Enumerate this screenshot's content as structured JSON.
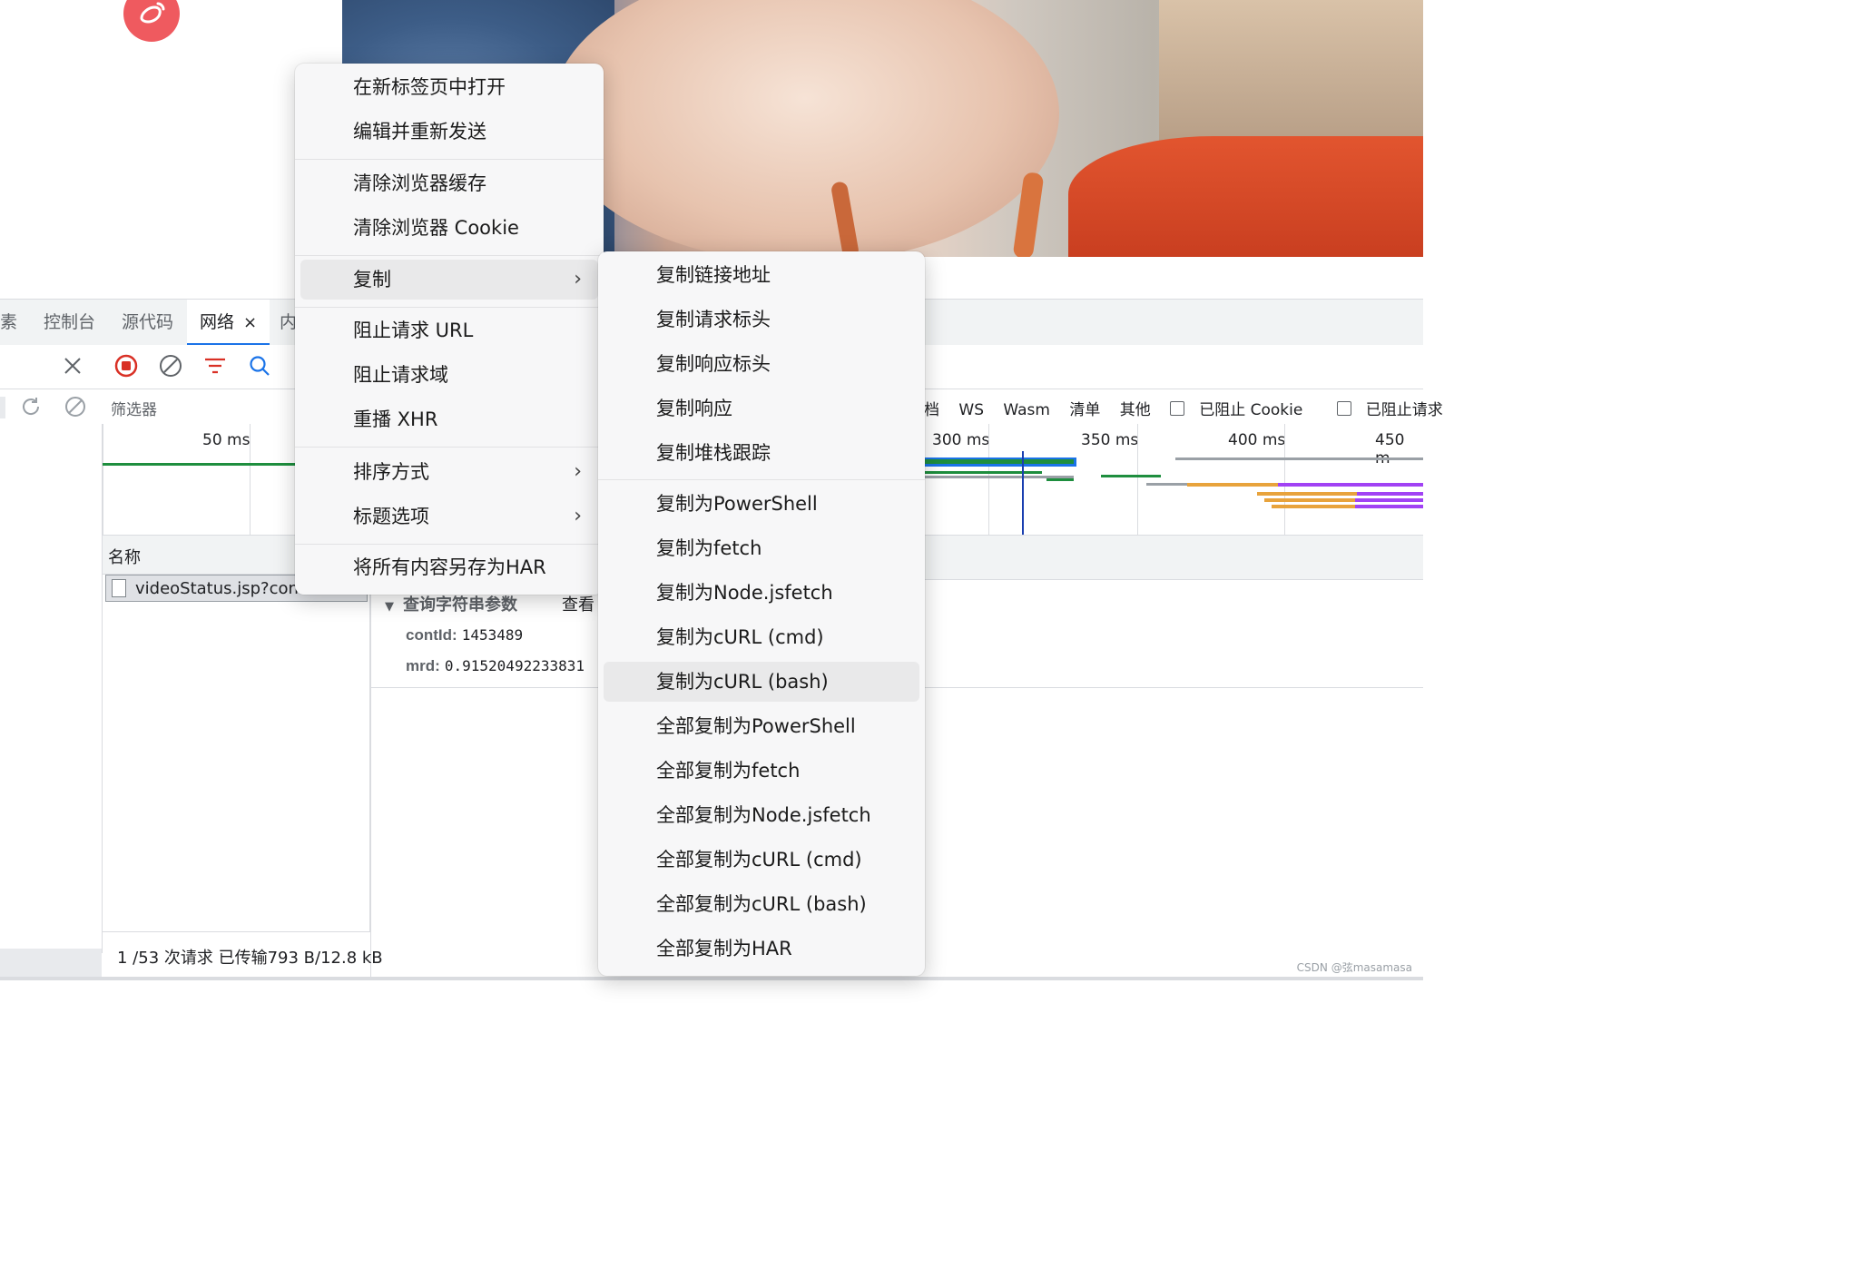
{
  "devtools": {
    "tabs": [
      "素",
      "控制台",
      "源代码",
      "网络",
      "内"
    ],
    "active_tab_close": "×"
  },
  "filter": {
    "placeholder": "筛选器",
    "types": [
      "档",
      "WS",
      "Wasm",
      "清单",
      "其他"
    ],
    "blocked_cookies": "已阻止 Cookie",
    "blocked_requests": "已阻止请求"
  },
  "overview": {
    "ticks": [
      "50 ms",
      "300 ms",
      "350 ms",
      "400 ms",
      "450 m"
    ]
  },
  "requests": {
    "column_name": "名称",
    "rows": [
      "videoStatus.jsp?contId=1453..."
    ]
  },
  "details": {
    "query_title": "查询字符串参数",
    "view_link": "查看",
    "params": [
      {
        "key": "contId:",
        "value": "1453489"
      },
      {
        "key": "mrd:",
        "value": "0.91520492233831"
      }
    ]
  },
  "status": "1 /53 次请求  已传输793 B/12.8 kB",
  "main_menu": {
    "items": [
      "在新标签页中打开",
      "编辑并重新发送",
      "清除浏览器缓存",
      "清除浏览器 Cookie",
      "复制",
      "阻止请求 URL",
      "阻止请求域",
      "重播 XHR",
      "排序方式",
      "标题选项",
      "将所有内容另存为HAR"
    ]
  },
  "copy_submenu": {
    "items": [
      "复制链接地址",
      "复制请求标头",
      "复制响应标头",
      "复制响应",
      "复制堆栈跟踪",
      "复制为PowerShell",
      "复制为fetch",
      "复制为Node.jsfetch",
      "复制为cURL (cmd)",
      "复制为cURL (bash)",
      "全部复制为PowerShell",
      "全部复制为fetch",
      "全部复制为Node.jsfetch",
      "全部复制为cURL (cmd)",
      "全部复制为cURL (bash)",
      "全部复制为HAR"
    ]
  },
  "watermark": "CSDN @弦masamasa",
  "colors": {
    "accent": "#1a73e8",
    "record_red": "#d93025",
    "logo_red": "#ef5a5f"
  }
}
